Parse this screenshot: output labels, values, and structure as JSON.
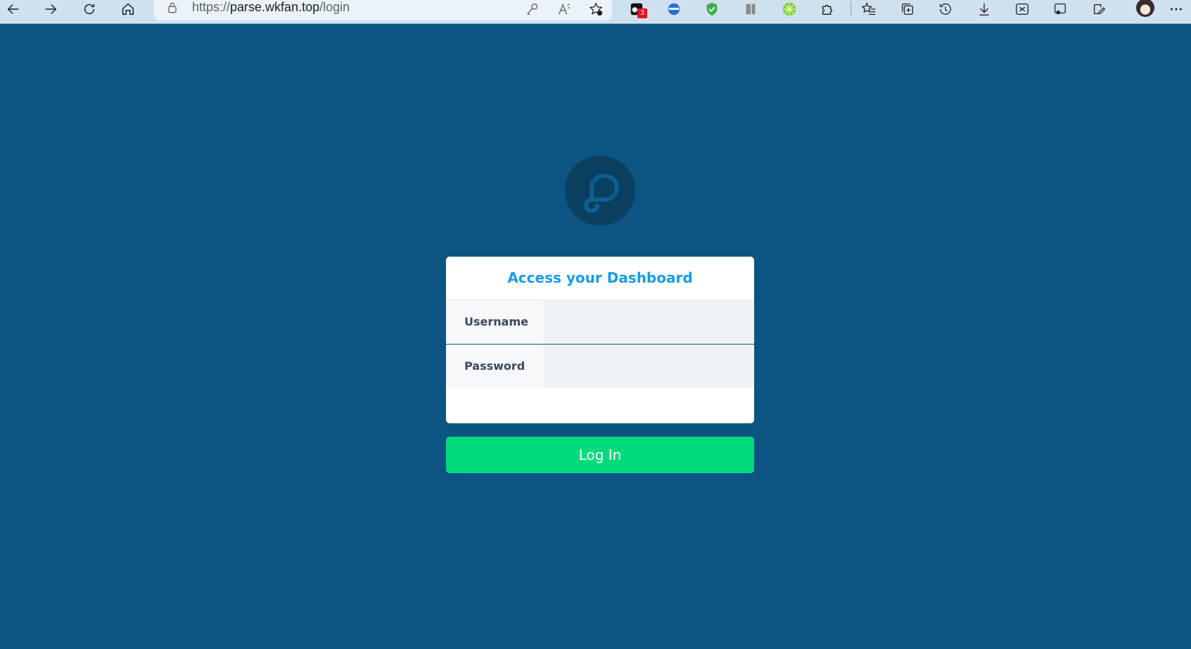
{
  "browser": {
    "url_scheme": "https://",
    "url_host": "parse.wkfan.top",
    "url_path": "/login",
    "extension_badge": "3"
  },
  "login": {
    "title": "Access your Dashboard",
    "username_label": "Username",
    "username_value": "",
    "password_label": "Password",
    "password_value": "",
    "submit_label": "Log In"
  },
  "colors": {
    "page_background": "#0c5582",
    "logo_circle": "#0a3f60",
    "title_accent": "#169cee",
    "button": "#00db7c"
  }
}
